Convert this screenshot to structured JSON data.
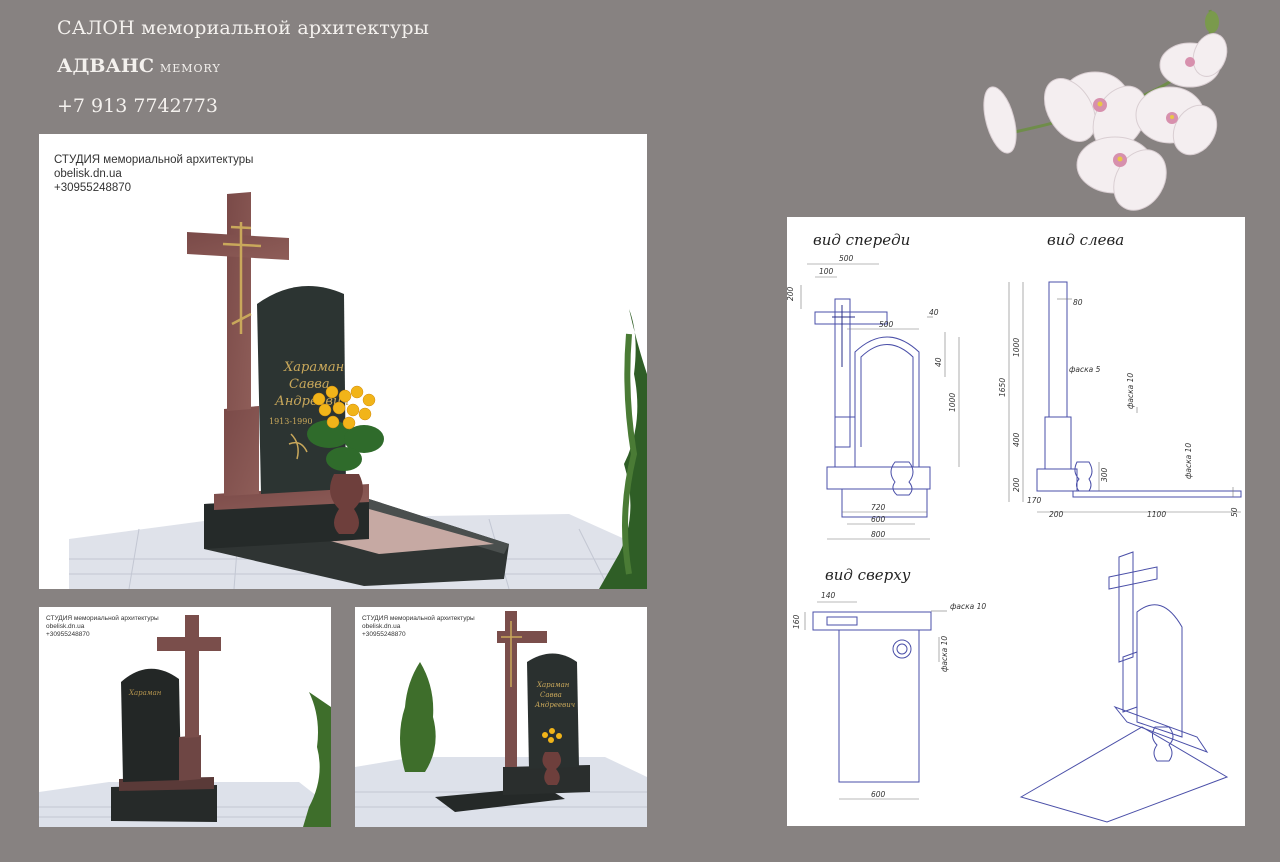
{
  "header": {
    "line1": "САЛОН мемориальной архитектуры",
    "brand": "АДВАНС",
    "brand_small": "MEMORY",
    "phone": "+7 913 7742773"
  },
  "studio": {
    "name": "СТУДИЯ мемориальной архитектуры",
    "site": "obelisk.dn.ua",
    "phone": "+30955248870"
  },
  "inscription": {
    "line1": "Хараман",
    "line2": "Савва",
    "line3": "Андреевич",
    "dates": "1913-1990"
  },
  "drawing": {
    "front_title": "вид спереди",
    "side_title": "вид слева",
    "top_title": "вид сверху",
    "front_dims": [
      "500",
      "100",
      "200",
      "500",
      "40",
      "40",
      "1000",
      "720",
      "600",
      "800"
    ],
    "side_dims": [
      "1000",
      "1650",
      "80",
      "фаска 5",
      "фаска 10",
      "400",
      "300",
      "200",
      "170",
      "200",
      "1100",
      "фаска 10",
      "50"
    ],
    "top_dims": [
      "140",
      "160",
      "фаска 10",
      "фаска 10",
      "600"
    ]
  }
}
